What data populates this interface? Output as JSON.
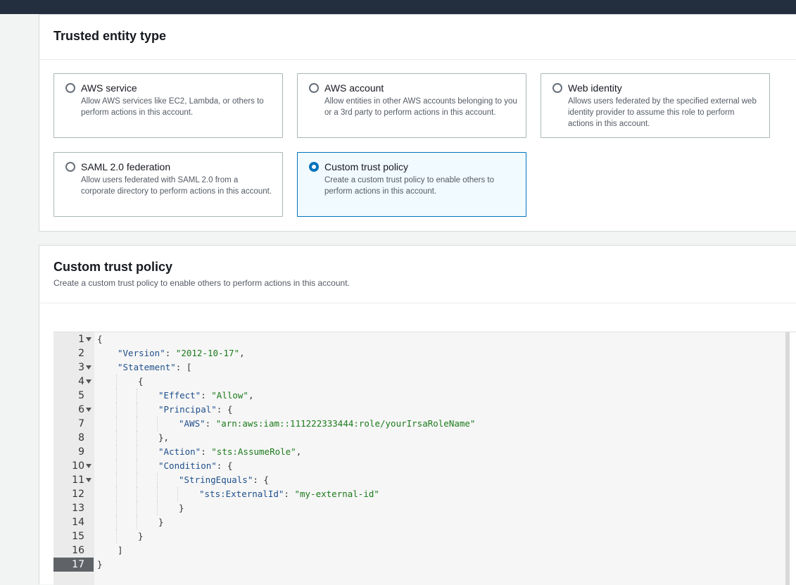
{
  "trusted_entity": {
    "title": "Trusted entity type",
    "options": [
      {
        "label": "AWS service",
        "desc": "Allow AWS services like EC2, Lambda, or others to perform actions in this account.",
        "selected": false
      },
      {
        "label": "AWS account",
        "desc": "Allow entities in other AWS accounts belonging to you or a 3rd party to perform actions in this account.",
        "selected": false
      },
      {
        "label": "Web identity",
        "desc": "Allows users federated by the specified external web identity provider to assume this role to perform actions in this account.",
        "selected": false
      },
      {
        "label": "SAML 2.0 federation",
        "desc": "Allow users federated with SAML 2.0 from a corporate directory to perform actions in this account.",
        "selected": false
      },
      {
        "label": "Custom trust policy",
        "desc": "Create a custom trust policy to enable others to perform actions in this account.",
        "selected": true
      }
    ]
  },
  "custom_policy": {
    "title": "Custom trust policy",
    "desc": "Create a custom trust policy to enable others to perform actions in this account.",
    "editor": {
      "active_line": 17,
      "lines": [
        {
          "n": "1",
          "fold": true,
          "indent": 0,
          "parts": [
            [
              "p",
              "{"
            ]
          ]
        },
        {
          "n": "2",
          "fold": false,
          "indent": 1,
          "parts": [
            [
              "k",
              "\"Version\""
            ],
            [
              "p",
              ": "
            ],
            [
              "s",
              "\"2012-10-17\""
            ],
            [
              "p",
              ","
            ]
          ]
        },
        {
          "n": "3",
          "fold": true,
          "indent": 1,
          "parts": [
            [
              "k",
              "\"Statement\""
            ],
            [
              "p",
              ": ["
            ]
          ]
        },
        {
          "n": "4",
          "fold": true,
          "indent": 2,
          "parts": [
            [
              "p",
              "{"
            ]
          ]
        },
        {
          "n": "5",
          "fold": false,
          "indent": 3,
          "parts": [
            [
              "k",
              "\"Effect\""
            ],
            [
              "p",
              ": "
            ],
            [
              "s",
              "\"Allow\""
            ],
            [
              "p",
              ","
            ]
          ]
        },
        {
          "n": "6",
          "fold": true,
          "indent": 3,
          "parts": [
            [
              "k",
              "\"Principal\""
            ],
            [
              "p",
              ": {"
            ]
          ]
        },
        {
          "n": "7",
          "fold": false,
          "indent": 4,
          "parts": [
            [
              "k",
              "\"AWS\""
            ],
            [
              "p",
              ": "
            ],
            [
              "s",
              "\"arn:aws:iam::111222333444:role/yourIrsaRoleName\""
            ]
          ]
        },
        {
          "n": "8",
          "fold": false,
          "indent": 3,
          "parts": [
            [
              "p",
              "},"
            ]
          ]
        },
        {
          "n": "9",
          "fold": false,
          "indent": 3,
          "parts": [
            [
              "k",
              "\"Action\""
            ],
            [
              "p",
              ": "
            ],
            [
              "s",
              "\"sts:AssumeRole\""
            ],
            [
              "p",
              ","
            ]
          ]
        },
        {
          "n": "10",
          "fold": true,
          "indent": 3,
          "parts": [
            [
              "k",
              "\"Condition\""
            ],
            [
              "p",
              ": {"
            ]
          ]
        },
        {
          "n": "11",
          "fold": true,
          "indent": 4,
          "parts": [
            [
              "k",
              "\"StringEquals\""
            ],
            [
              "p",
              ": {"
            ]
          ]
        },
        {
          "n": "12",
          "fold": false,
          "indent": 5,
          "parts": [
            [
              "k",
              "\"sts:ExternalId\""
            ],
            [
              "p",
              ": "
            ],
            [
              "s",
              "\"my-external-id\""
            ]
          ]
        },
        {
          "n": "13",
          "fold": false,
          "indent": 4,
          "parts": [
            [
              "p",
              "}"
            ]
          ]
        },
        {
          "n": "14",
          "fold": false,
          "indent": 3,
          "parts": [
            [
              "p",
              "}"
            ]
          ]
        },
        {
          "n": "15",
          "fold": false,
          "indent": 2,
          "parts": [
            [
              "p",
              "}"
            ]
          ]
        },
        {
          "n": "16",
          "fold": false,
          "indent": 1,
          "parts": [
            [
              "p",
              "]"
            ]
          ]
        },
        {
          "n": "17",
          "fold": false,
          "indent": 0,
          "parts": [
            [
              "p",
              "}"
            ]
          ]
        }
      ]
    }
  }
}
